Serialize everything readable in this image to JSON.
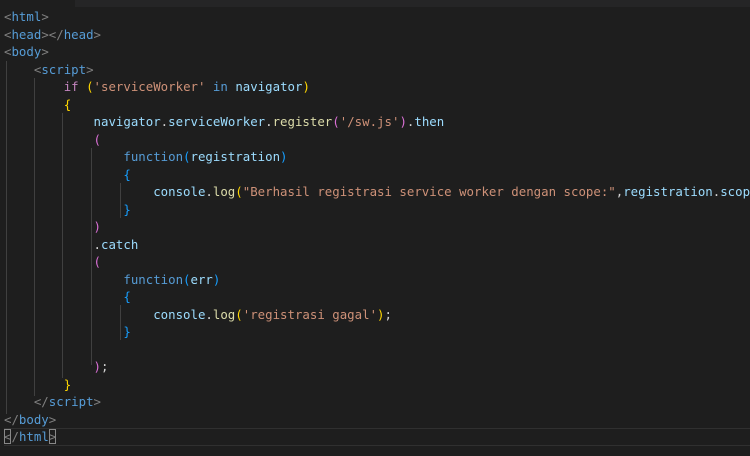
{
  "editor": {
    "lines": [
      [
        {
          "t": "<",
          "c": "punct"
        },
        {
          "t": "html",
          "c": "tag"
        },
        {
          "t": ">",
          "c": "punct"
        }
      ],
      [
        {
          "t": "<",
          "c": "punct"
        },
        {
          "t": "head",
          "c": "tag"
        },
        {
          "t": "></",
          "c": "punct"
        },
        {
          "t": "head",
          "c": "tag"
        },
        {
          "t": ">",
          "c": "punct"
        }
      ],
      [
        {
          "t": "<",
          "c": "punct"
        },
        {
          "t": "body",
          "c": "tag"
        },
        {
          "t": ">",
          "c": "punct"
        }
      ],
      [
        {
          "t": "    "
        },
        {
          "t": "<",
          "c": "punct"
        },
        {
          "t": "script",
          "c": "tag"
        },
        {
          "t": ">",
          "c": "punct"
        }
      ],
      [
        {
          "t": "        "
        },
        {
          "t": "if",
          "c": "kw"
        },
        {
          "t": " "
        },
        {
          "t": "(",
          "c": "b1"
        },
        {
          "t": "'serviceWorker'",
          "c": "str"
        },
        {
          "t": " "
        },
        {
          "t": "in",
          "c": "tag"
        },
        {
          "t": " "
        },
        {
          "t": "navigator",
          "c": "var"
        },
        {
          "t": ")",
          "c": "b1"
        }
      ],
      [
        {
          "t": "        "
        },
        {
          "t": "{",
          "c": "b1"
        }
      ],
      [
        {
          "t": "            "
        },
        {
          "t": "navigator",
          "c": "var"
        },
        {
          "t": "."
        },
        {
          "t": "serviceWorker",
          "c": "var"
        },
        {
          "t": "."
        },
        {
          "t": "register",
          "c": "fn"
        },
        {
          "t": "(",
          "c": "b2"
        },
        {
          "t": "'/sw.js'",
          "c": "str"
        },
        {
          "t": ")",
          "c": "b2"
        },
        {
          "t": "."
        },
        {
          "t": "then",
          "c": "var"
        }
      ],
      [
        {
          "t": "            "
        },
        {
          "t": "(",
          "c": "b2"
        }
      ],
      [
        {
          "t": "                "
        },
        {
          "t": "function",
          "c": "tag"
        },
        {
          "t": "(",
          "c": "b3"
        },
        {
          "t": "registration",
          "c": "var"
        },
        {
          "t": ")",
          "c": "b3"
        }
      ],
      [
        {
          "t": "                "
        },
        {
          "t": "{",
          "c": "b3"
        }
      ],
      [
        {
          "t": "                    "
        },
        {
          "t": "console",
          "c": "var"
        },
        {
          "t": "."
        },
        {
          "t": "log",
          "c": "fn"
        },
        {
          "t": "(",
          "c": "b1"
        },
        {
          "t": "\"Berhasil registrasi service worker dengan scope:\"",
          "c": "str"
        },
        {
          "t": ","
        },
        {
          "t": "registration",
          "c": "var"
        },
        {
          "t": "."
        },
        {
          "t": "scope",
          "c": "var"
        },
        {
          "t": ")",
          "c": "b1"
        },
        {
          "t": ";"
        }
      ],
      [
        {
          "t": "                "
        },
        {
          "t": "}",
          "c": "b3"
        }
      ],
      [
        {
          "t": "            "
        },
        {
          "t": ")",
          "c": "b2"
        }
      ],
      [
        {
          "t": "            "
        },
        {
          "t": "."
        },
        {
          "t": "catch",
          "c": "var"
        }
      ],
      [
        {
          "t": "            "
        },
        {
          "t": "(",
          "c": "b2"
        }
      ],
      [
        {
          "t": "                "
        },
        {
          "t": "function",
          "c": "tag"
        },
        {
          "t": "(",
          "c": "b3"
        },
        {
          "t": "err",
          "c": "var"
        },
        {
          "t": ")",
          "c": "b3"
        }
      ],
      [
        {
          "t": "                "
        },
        {
          "t": "{",
          "c": "b3"
        }
      ],
      [
        {
          "t": "                    "
        },
        {
          "t": "console",
          "c": "var"
        },
        {
          "t": "."
        },
        {
          "t": "log",
          "c": "fn"
        },
        {
          "t": "(",
          "c": "b1"
        },
        {
          "t": "'registrasi gagal'",
          "c": "str"
        },
        {
          "t": ")",
          "c": "b1"
        },
        {
          "t": ";"
        }
      ],
      [
        {
          "t": "                "
        },
        {
          "t": "}",
          "c": "b3"
        }
      ],
      [],
      [
        {
          "t": "            "
        },
        {
          "t": ")",
          "c": "b2"
        },
        {
          "t": ";"
        }
      ],
      [
        {
          "t": "        "
        },
        {
          "t": "}",
          "c": "b1"
        }
      ],
      [
        {
          "t": "    "
        },
        {
          "t": "</",
          "c": "punct"
        },
        {
          "t": "script",
          "c": "tag"
        },
        {
          "t": ">",
          "c": "punct"
        }
      ],
      [
        {
          "t": "</",
          "c": "punct"
        },
        {
          "t": "body",
          "c": "tag"
        },
        {
          "t": ">",
          "c": "punct"
        }
      ],
      [
        {
          "t": "<",
          "c": "punct",
          "hl": true
        },
        {
          "t": "/",
          "c": "punct"
        },
        {
          "t": "html",
          "c": "tag"
        },
        {
          "t": ">",
          "c": "punct",
          "hl": true
        }
      ]
    ],
    "current_line": 24,
    "colors": {
      "background": "#1e1e1e",
      "tag": "#569cd6",
      "keyword": "#c586c0",
      "string": "#ce9178",
      "variable": "#9cdcfe",
      "function": "#dcdcaa",
      "bracket_level1": "#ffd700",
      "bracket_level2": "#da70d6",
      "bracket_level3": "#179fff"
    }
  }
}
